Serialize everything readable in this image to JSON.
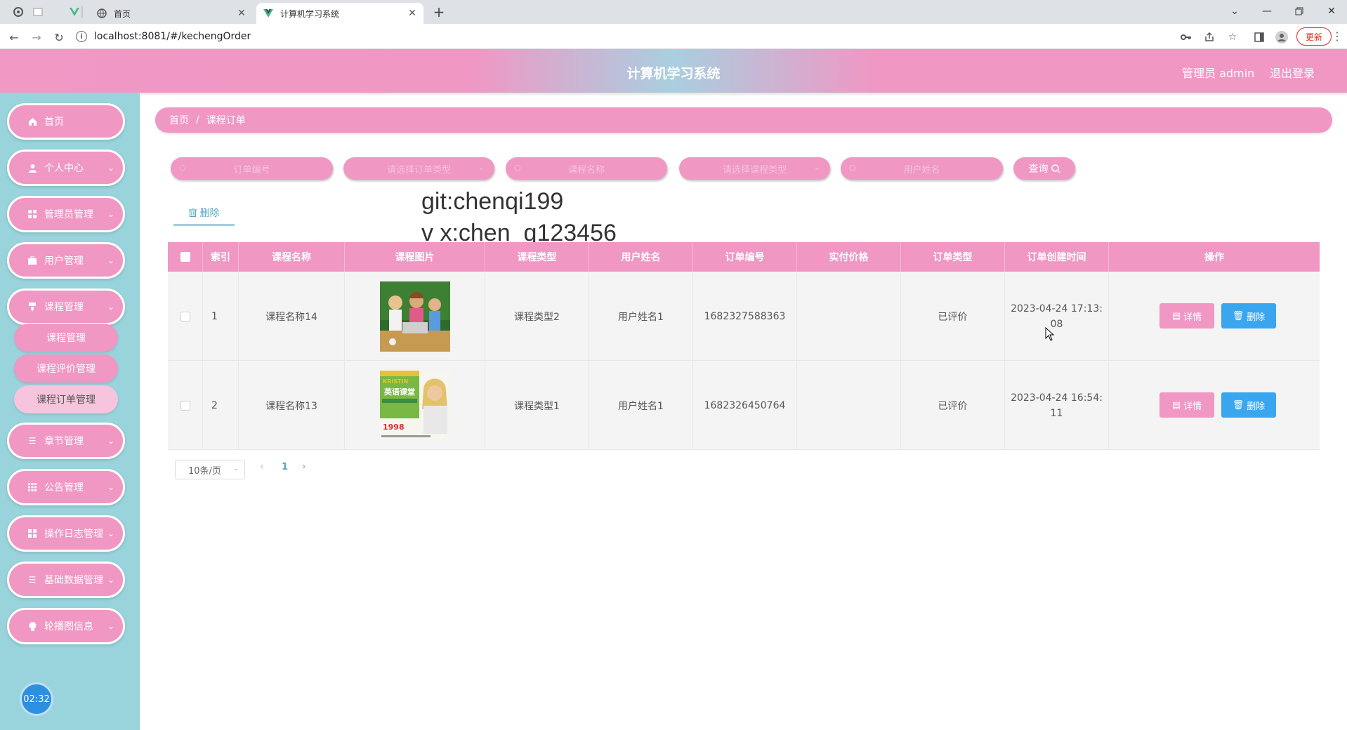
{
  "browser": {
    "tabs": [
      {
        "title": "首页",
        "active": false
      },
      {
        "title": "计算机学习系统",
        "active": true
      }
    ],
    "url": "localhost:8081/#/kechengOrder",
    "update_label": "更新"
  },
  "header": {
    "title": "计算机学习系统",
    "user": "管理员 admin",
    "logout": "退出登录"
  },
  "sidebar": {
    "items": [
      {
        "label": "首页",
        "icon": "home-icon"
      },
      {
        "label": "个人中心",
        "icon": "user-icon"
      },
      {
        "label": "管理员管理",
        "icon": "grid-icon"
      },
      {
        "label": "用户管理",
        "icon": "briefcase-icon"
      },
      {
        "label": "课程管理",
        "icon": "goods-icon"
      },
      {
        "label": "章节管理",
        "icon": "menu-icon"
      },
      {
        "label": "公告管理",
        "icon": "apps-icon"
      },
      {
        "label": "操作日志管理",
        "icon": "grid-icon"
      },
      {
        "label": "基础数据管理",
        "icon": "menu-icon"
      },
      {
        "label": "轮播图信息",
        "icon": "bulb-icon"
      }
    ],
    "submenu": [
      {
        "label": "课程管理"
      },
      {
        "label": "课程评价管理"
      },
      {
        "label": "课程订单管理"
      }
    ],
    "timer": "02:32"
  },
  "breadcrumb": {
    "home": "首页",
    "sep": "/",
    "current": "课程订单"
  },
  "filters": {
    "order_no": "订单编号",
    "order_type": "请选择订单类型",
    "course_name": "课程名称",
    "course_type": "请选择课程类型",
    "user_name": "用户姓名",
    "search": "查询"
  },
  "actions": {
    "delete": "删除"
  },
  "watermark": {
    "line1": "git:chenqi199",
    "line2": "v x:chen_q123456"
  },
  "table": {
    "headers": [
      "索引",
      "课程名称",
      "课程图片",
      "课程类型",
      "用户姓名",
      "订单编号",
      "实付价格",
      "订单类型",
      "订单创建时间",
      "操作"
    ],
    "rows": [
      {
        "index": "1",
        "course": "课程名称14",
        "type": "课程类型2",
        "user": "用户姓名1",
        "order_no": "1682327588363",
        "price": "",
        "order_type": "已评价",
        "created_1": "2023-04-24 17:13:",
        "created_2": "08"
      },
      {
        "index": "2",
        "course": "课程名称13",
        "type": "课程类型1",
        "user": "用户姓名1",
        "order_no": "1682326450764",
        "price": "",
        "order_type": "已评价",
        "created_1": "2023-04-24 16:54:",
        "created_2": "11"
      }
    ],
    "detail_label": "详情",
    "delete_label": "删除",
    "img2": {
      "top": "KRISTIN",
      "title": "英语课堂",
      "price": "1998"
    }
  },
  "pagination": {
    "page_size": "10条/页",
    "current": "1"
  }
}
